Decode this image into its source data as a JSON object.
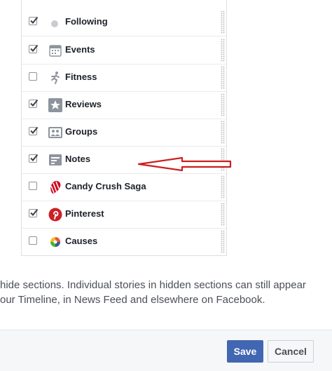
{
  "sections": [
    {
      "label": "Following",
      "checked": true,
      "icon": "following-icon"
    },
    {
      "label": "Events",
      "checked": true,
      "icon": "calendar-icon"
    },
    {
      "label": "Fitness",
      "checked": false,
      "icon": "runner-icon"
    },
    {
      "label": "Reviews",
      "checked": true,
      "icon": "star-icon"
    },
    {
      "label": "Groups",
      "checked": true,
      "icon": "groups-icon"
    },
    {
      "label": "Notes",
      "checked": true,
      "icon": "notes-icon"
    },
    {
      "label": "Candy Crush Saga",
      "checked": false,
      "icon": "candy-crush-icon"
    },
    {
      "label": "Pinterest",
      "checked": true,
      "icon": "pinterest-icon"
    },
    {
      "label": "Causes",
      "checked": false,
      "icon": "causes-icon"
    }
  ],
  "help_text": {
    "line1": "hide sections. Individual stories in hidden sections can still appear",
    "line2": "our Timeline, in News Feed and elsewhere on Facebook."
  },
  "buttons": {
    "save": "Save",
    "cancel": "Cancel"
  },
  "colors": {
    "primary": "#4267b2",
    "annotation_arrow": "#cc1f1f",
    "text": "#1d2129"
  }
}
